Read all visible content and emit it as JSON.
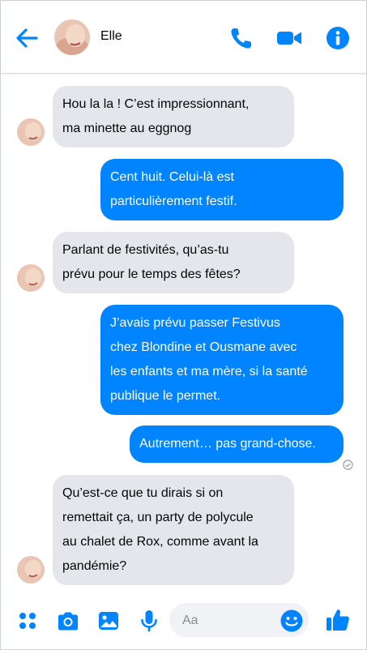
{
  "colors": {
    "accent": "#0084ff",
    "incoming_bubble": "#e4e6eb",
    "outgoing_text": "#ffffff"
  },
  "header": {
    "contact_name": "Elle",
    "icons": [
      "back-arrow-icon",
      "avatar",
      "phone-icon",
      "video-camera-icon",
      "info-icon"
    ]
  },
  "messages": [
    {
      "direction": "in",
      "lines": [
        "Hou la la ! C’est impressionnant,",
        "ma minette au eggnog"
      ]
    },
    {
      "direction": "out",
      "lines": [
        "Cent huit. Celui-là est",
        "particulièrement festif."
      ]
    },
    {
      "direction": "in",
      "lines": [
        "Parlant de festivités, qu’as-tu",
        "prévu pour le temps des fêtes?"
      ]
    },
    {
      "direction": "out",
      "lines": [
        "J’avais prévu passer  Festivus",
        "chez Blondine et Ousmane avec",
        "les enfants et ma mère, si la santé",
        "publique le permet."
      ]
    },
    {
      "direction": "out",
      "lines": [
        "Autrement… pas grand-chose."
      ]
    },
    {
      "direction": "in",
      "lines": [
        "Qu’est-ce que tu dirais si on",
        "remettait ça, un party de polycule",
        "au chalet de Rox, comme avant la",
        "pandémie?"
      ]
    }
  ],
  "composer": {
    "placeholder": "Aa",
    "icons": [
      "apps-grid-icon",
      "camera-icon",
      "image-icon",
      "microphone-icon",
      "emoji-icon",
      "thumbs-up-icon"
    ]
  }
}
